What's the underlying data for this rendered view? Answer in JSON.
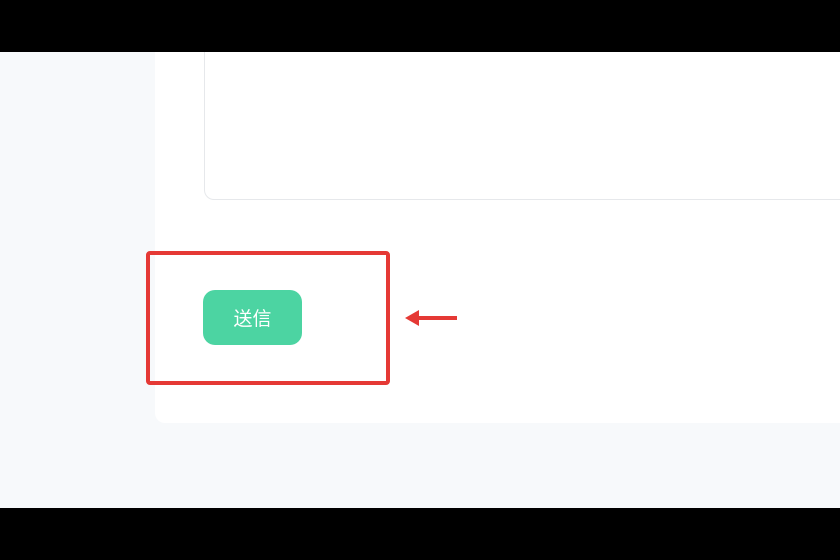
{
  "form": {
    "submit_label": "送信"
  },
  "annotation": {
    "highlight_color": "#e53935",
    "arrow_direction": "left"
  },
  "colors": {
    "accent": "#4cd4a2",
    "page_bg": "#f7f9fb",
    "card_bg": "#ffffff",
    "border": "#e6e8eb"
  }
}
